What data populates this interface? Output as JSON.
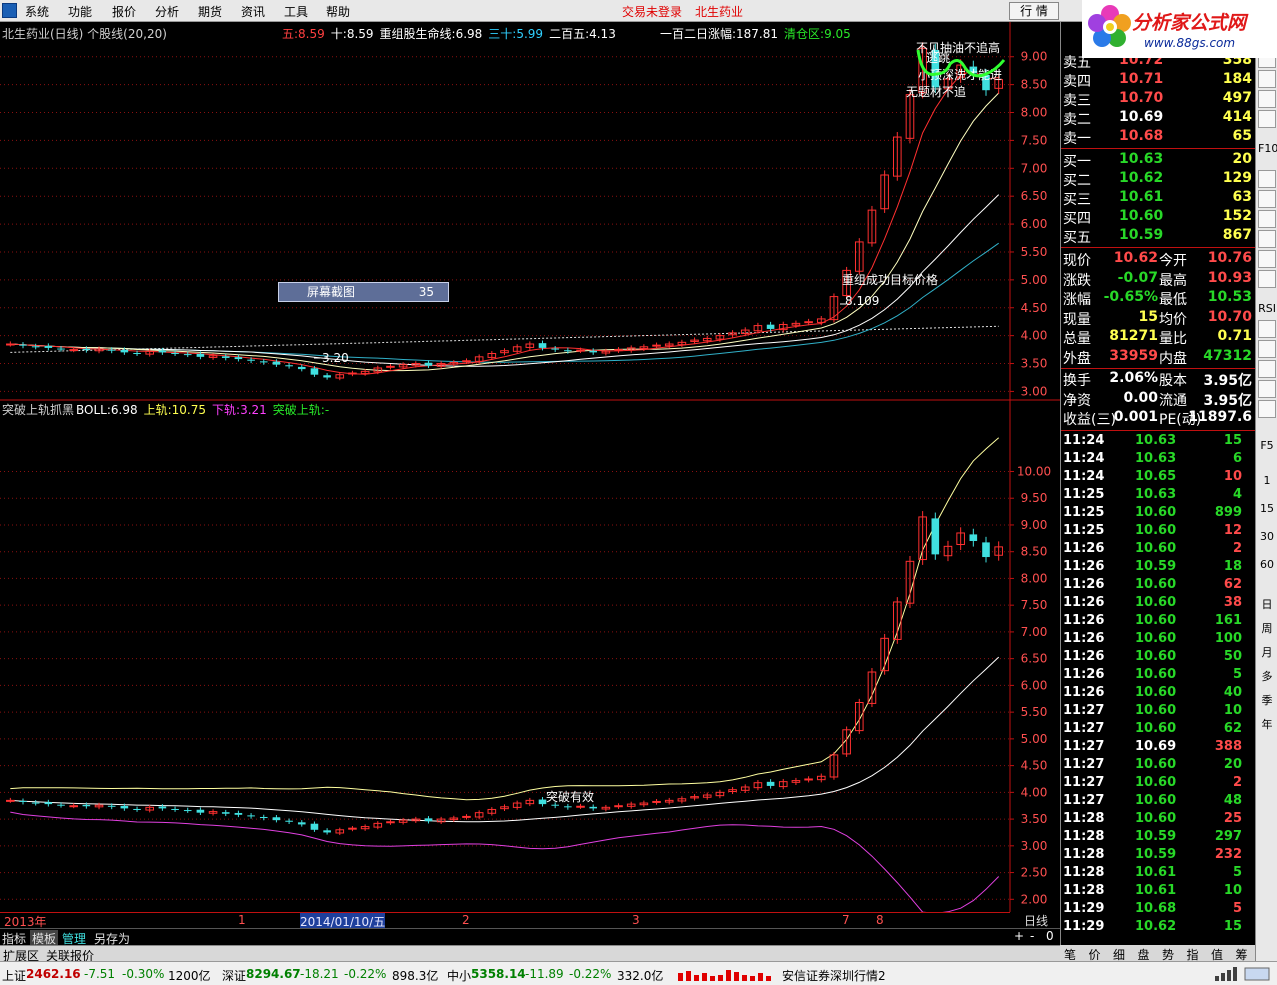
{
  "menu": {
    "items": [
      "系统",
      "功能",
      "报价",
      "分析",
      "期货",
      "资讯",
      "工具",
      "帮助"
    ],
    "trade_status": "交易未登录",
    "stock_name": "北生药业",
    "quote_button": "行 情"
  },
  "brand": {
    "title": "分析家公式网",
    "url": "www.88gs.com"
  },
  "main_header": {
    "title": "北生药业(日线) 个股线(20,20)",
    "items": [
      {
        "label": "五:",
        "value": "8.59",
        "color": "#ff4040"
      },
      {
        "label": "十:",
        "value": "8.59",
        "color": "#ffffff"
      },
      {
        "label": "重组股生命线:",
        "value": "6.98",
        "color": "#ffffff"
      },
      {
        "label": "三十:",
        "value": "5.99",
        "color": "#30d0ff"
      },
      {
        "label": "二百五:",
        "value": "4.13",
        "color": "#ffffff"
      },
      {
        "label": "一百二日涨幅:",
        "value": "187.81",
        "color": "#ffffff"
      },
      {
        "label": "清仓区:",
        "value": "9.05",
        "color": "#28e828"
      }
    ]
  },
  "sub_header": {
    "title": "突破上轨抓黑",
    "items": [
      {
        "label": "BOLL:",
        "value": "6.98",
        "color": "#ffffff"
      },
      {
        "label": "上轨:",
        "value": "10.75",
        "color": "#ffff50"
      },
      {
        "label": "下轨:",
        "value": "3.21",
        "color": "#ff40ff"
      },
      {
        "label": "突破上轨:",
        "value": "-",
        "color": "#28e828"
      }
    ]
  },
  "screenshot_box": {
    "label": "屏幕截图",
    "value": "35"
  },
  "annotations": {
    "top1": "不见抽油不追高",
    "top2": "逃跳",
    "top3": "小顶深洗才能进",
    "top4": "无题材不追",
    "target": "重组成功目标价格",
    "target_value": "8.109",
    "low": "3.20",
    "sub_breakout": "突破有效"
  },
  "chart_data": [
    {
      "type": "candlestick",
      "panel": "main",
      "ylim": [
        2.9,
        9.3
      ],
      "yticks": [
        "9.00",
        "8.50",
        "8.00",
        "7.50",
        "7.00",
        "6.50",
        "6.00",
        "5.50",
        "5.00",
        "4.50",
        "4.00",
        "3.50",
        "3.00"
      ],
      "close": [
        3.85,
        3.82,
        3.8,
        3.78,
        3.76,
        3.75,
        3.74,
        3.76,
        3.73,
        3.7,
        3.68,
        3.72,
        3.7,
        3.68,
        3.66,
        3.62,
        3.64,
        3.6,
        3.58,
        3.55,
        3.52,
        3.48,
        3.45,
        3.4,
        3.3,
        3.25,
        3.3,
        3.33,
        3.36,
        3.42,
        3.45,
        3.48,
        3.5,
        3.46,
        3.5,
        3.52,
        3.55,
        3.62,
        3.68,
        3.73,
        3.8,
        3.85,
        3.78,
        3.75,
        3.72,
        3.74,
        3.7,
        3.72,
        3.75,
        3.78,
        3.8,
        3.83,
        3.85,
        3.88,
        3.92,
        3.95,
        4.0,
        4.05,
        4.1,
        4.18,
        4.12,
        4.2,
        4.22,
        4.25,
        4.3,
        4.7,
        5.17,
        5.68,
        6.25,
        6.88,
        7.56,
        8.32,
        9.15,
        8.45,
        8.6,
        8.85,
        8.7,
        8.4,
        8.59
      ],
      "ma_series": [
        "五",
        "十",
        "三十",
        "二百五",
        "重组股生命线"
      ]
    },
    {
      "type": "candlestick",
      "panel": "sub",
      "ylim": [
        1.8,
        11.0
      ],
      "yticks": [
        "10.00",
        "9.50",
        "9.00",
        "8.50",
        "8.00",
        "7.50",
        "7.00",
        "6.50",
        "6.00",
        "5.50",
        "5.00",
        "4.50",
        "4.00",
        "3.50",
        "3.00",
        "2.50",
        "2.00"
      ],
      "series": [
        {
          "name": "BOLL",
          "last": 6.98
        },
        {
          "name": "上轨",
          "last": 10.75
        },
        {
          "name": "下轨",
          "last": 3.21
        }
      ]
    }
  ],
  "xaxis": {
    "labels": [
      {
        "text": "2013年",
        "sel": false
      },
      {
        "text": "1",
        "sel": false
      },
      {
        "text": "2014/01/10/五",
        "sel": true
      },
      {
        "text": "2",
        "sel": false
      },
      {
        "text": "3",
        "sel": false
      },
      {
        "text": "7",
        "sel": false
      },
      {
        "text": "8",
        "sel": false
      }
    ],
    "period": "日线"
  },
  "tabs": [
    "指标",
    "模板",
    "管理",
    "另存为"
  ],
  "ctrl": [
    "+",
    "-",
    "0"
  ],
  "ext_bar": [
    "扩展区",
    "关联报价"
  ],
  "orderbook": {
    "asks": [
      {
        "label": "卖五",
        "price": "10.72",
        "vol": "358"
      },
      {
        "label": "卖四",
        "price": "10.71",
        "vol": "184"
      },
      {
        "label": "卖三",
        "price": "10.70",
        "vol": "497"
      },
      {
        "label": "卖二",
        "price": "10.69",
        "vol": "414"
      },
      {
        "label": "卖一",
        "price": "10.68",
        "vol": "65"
      }
    ],
    "bids": [
      {
        "label": "买一",
        "price": "10.63",
        "vol": "20"
      },
      {
        "label": "买二",
        "price": "10.62",
        "vol": "129"
      },
      {
        "label": "买三",
        "price": "10.61",
        "vol": "63"
      },
      {
        "label": "买四",
        "price": "10.60",
        "vol": "152"
      },
      {
        "label": "买五",
        "price": "10.59",
        "vol": "867"
      }
    ]
  },
  "stats": [
    {
      "l1": "现价",
      "v1": "10.62",
      "c1": "red",
      "l2": "今开",
      "v2": "10.76",
      "c2": "red"
    },
    {
      "l1": "涨跌",
      "v1": "-0.07",
      "c1": "green",
      "l2": "最高",
      "v2": "10.93",
      "c2": "red"
    },
    {
      "l1": "涨幅",
      "v1": "-0.65%",
      "c1": "green",
      "l2": "最低",
      "v2": "10.53",
      "c2": "green"
    },
    {
      "l1": "现量",
      "v1": "15",
      "c1": "yel",
      "l2": "均价",
      "v2": "10.70",
      "c2": "red"
    },
    {
      "l1": "总量",
      "v1": "81271",
      "c1": "yel",
      "l2": "量比",
      "v2": "0.71",
      "c2": "yel"
    },
    {
      "l1": "外盘",
      "v1": "33959",
      "c1": "red",
      "l2": "内盘",
      "v2": "47312",
      "c2": "green"
    },
    {
      "l1": "换手",
      "v1": "2.06%",
      "c1": "white",
      "l2": "股本",
      "v2": "3.95亿",
      "c2": "white"
    },
    {
      "l1": "净资",
      "v1": "0.00",
      "c1": "white",
      "l2": "流通",
      "v2": "3.95亿",
      "c2": "white"
    },
    {
      "l1": "收益(三)",
      "v1": "0.001",
      "c1": "white",
      "l2": "PE(动)",
      "v2": "11897.6",
      "c2": "white"
    }
  ],
  "ticks": [
    {
      "t": "11:24",
      "p": "10.63",
      "v": "15",
      "c": "green"
    },
    {
      "t": "11:24",
      "p": "10.63",
      "v": "6",
      "c": "green"
    },
    {
      "t": "11:24",
      "p": "10.65",
      "v": "10",
      "c": "red"
    },
    {
      "t": "11:25",
      "p": "10.63",
      "v": "4",
      "c": "green"
    },
    {
      "t": "11:25",
      "p": "10.60",
      "v": "899",
      "c": "green"
    },
    {
      "t": "11:25",
      "p": "10.60",
      "v": "12",
      "c": "red"
    },
    {
      "t": "11:26",
      "p": "10.60",
      "v": "2",
      "c": "red"
    },
    {
      "t": "11:26",
      "p": "10.59",
      "v": "18",
      "c": "green"
    },
    {
      "t": "11:26",
      "p": "10.60",
      "v": "62",
      "c": "red"
    },
    {
      "t": "11:26",
      "p": "10.60",
      "v": "38",
      "c": "red"
    },
    {
      "t": "11:26",
      "p": "10.60",
      "v": "161",
      "c": "green"
    },
    {
      "t": "11:26",
      "p": "10.60",
      "v": "100",
      "c": "green"
    },
    {
      "t": "11:26",
      "p": "10.60",
      "v": "50",
      "c": "green"
    },
    {
      "t": "11:26",
      "p": "10.60",
      "v": "5",
      "c": "green"
    },
    {
      "t": "11:26",
      "p": "10.60",
      "v": "40",
      "c": "green"
    },
    {
      "t": "11:27",
      "p": "10.60",
      "v": "10",
      "c": "green"
    },
    {
      "t": "11:27",
      "p": "10.60",
      "v": "62",
      "c": "green"
    },
    {
      "t": "11:27",
      "p": "10.69",
      "v": "388",
      "c": "red",
      "pw": true
    },
    {
      "t": "11:27",
      "p": "10.60",
      "v": "20",
      "c": "green"
    },
    {
      "t": "11:27",
      "p": "10.60",
      "v": "2",
      "c": "red"
    },
    {
      "t": "11:27",
      "p": "10.60",
      "v": "48",
      "c": "green"
    },
    {
      "t": "11:28",
      "p": "10.60",
      "v": "25",
      "c": "red"
    },
    {
      "t": "11:28",
      "p": "10.59",
      "v": "297",
      "c": "green"
    },
    {
      "t": "11:28",
      "p": "10.59",
      "v": "232",
      "c": "red"
    },
    {
      "t": "11:28",
      "p": "10.61",
      "v": "5",
      "c": "green"
    },
    {
      "t": "11:28",
      "p": "10.61",
      "v": "10",
      "c": "green"
    },
    {
      "t": "11:29",
      "p": "10.68",
      "v": "5",
      "c": "red"
    },
    {
      "t": "11:29",
      "p": "10.62",
      "v": "15",
      "c": "green"
    }
  ],
  "right_tabs": [
    "笔",
    "价",
    "细",
    "盘",
    "势",
    "指",
    "值",
    "筹"
  ],
  "toolbar": [
    "F10",
    "RSI",
    "F5",
    "1",
    "15",
    "30",
    "60",
    "日",
    "周",
    "月",
    "多",
    "季",
    "年"
  ],
  "status": {
    "sh_label": "上证",
    "sh_val": "2462.16",
    "sh_chg": "-7.51",
    "sh_pct": "-0.30%",
    "sh_amt": "1200亿",
    "sz_label": "深证",
    "sz_val": "8294.67",
    "sz_chg": "-18.21",
    "sz_pct": "-0.22%",
    "sz_amt": "898.3亿",
    "zx_label": "中小",
    "zx_val": "5358.14",
    "zx_chg": "-11.89",
    "zx_pct": "-0.22%",
    "zx_amt": "332.0亿",
    "broker": "安信证券深圳行情2"
  }
}
